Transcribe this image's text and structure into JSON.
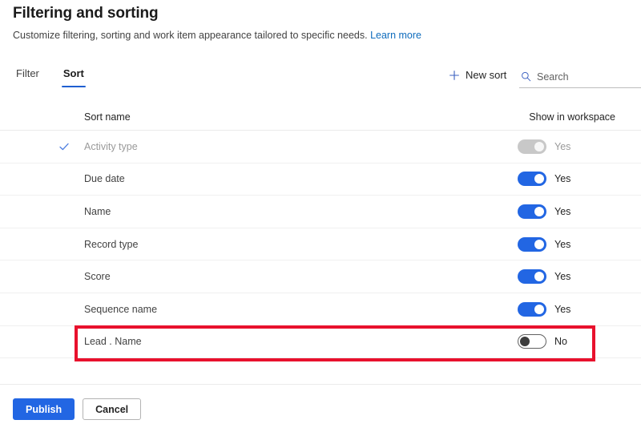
{
  "header": {
    "title": "Filtering and sorting",
    "subtitle": "Customize filtering, sorting and work item appearance tailored to specific needs.",
    "learn_more": "Learn more"
  },
  "tabs": [
    {
      "label": "Filter",
      "active": false
    },
    {
      "label": "Sort",
      "active": true
    }
  ],
  "toolbar": {
    "new_sort_label": "New sort",
    "plus_icon": "plus-icon",
    "search_icon": "search-icon",
    "search_placeholder": "Search",
    "search_value": ""
  },
  "table": {
    "columns": {
      "name": "Sort name",
      "show": "Show in workspace"
    },
    "rows": [
      {
        "name": "Activity type",
        "checked": true,
        "toggle_state": "disabled",
        "toggle_label": "Yes",
        "highlighted": false
      },
      {
        "name": "Due date",
        "checked": false,
        "toggle_state": "on",
        "toggle_label": "Yes",
        "highlighted": false
      },
      {
        "name": "Name",
        "checked": false,
        "toggle_state": "on",
        "toggle_label": "Yes",
        "highlighted": false
      },
      {
        "name": "Record type",
        "checked": false,
        "toggle_state": "on",
        "toggle_label": "Yes",
        "highlighted": false
      },
      {
        "name": "Score",
        "checked": false,
        "toggle_state": "on",
        "toggle_label": "Yes",
        "highlighted": false
      },
      {
        "name": "Sequence name",
        "checked": false,
        "toggle_state": "on",
        "toggle_label": "Yes",
        "highlighted": false
      },
      {
        "name": "Lead . Name",
        "checked": false,
        "toggle_state": "off",
        "toggle_label": "No",
        "highlighted": true
      }
    ]
  },
  "footer": {
    "publish_label": "Publish",
    "cancel_label": "Cancel"
  },
  "colors": {
    "accent_blue": "#2266e3",
    "link_blue": "#0f6cbd",
    "tab_underline": "#1f5fd1",
    "highlight_red": "#e8112d",
    "toggle_disabled": "#c8c8c8",
    "text_primary": "#242424",
    "text_secondary": "#424242",
    "text_dim": "#9a9a9a"
  }
}
